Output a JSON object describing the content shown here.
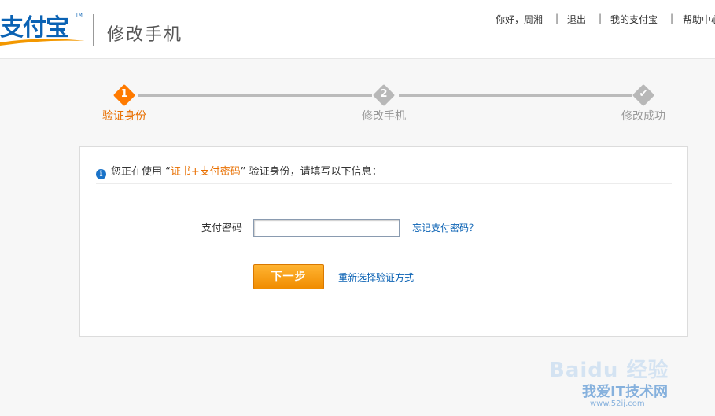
{
  "header": {
    "logo_text": "支付宝",
    "logo_tm": "TM",
    "page_title": "修改手机",
    "nav": {
      "greeting": "你好，周湘",
      "logout": "退出",
      "my_alipay": "我的支付宝",
      "help_center": "帮助中心"
    }
  },
  "steps": [
    {
      "number": "1",
      "label": "验证身份",
      "state": "active"
    },
    {
      "number": "2",
      "label": "修改手机",
      "state": "pending"
    },
    {
      "number": "✔",
      "label": "修改成功",
      "state": "pending"
    }
  ],
  "main": {
    "info_icon": "info-icon",
    "info_prefix": "您正在使用 “",
    "info_method": "证书+支付密码",
    "info_suffix": "” 验证身份，请填写以下信息：",
    "password_label": "支付密码",
    "password_value": "",
    "forgot_link": "忘记支付密码？",
    "next_button": "下一步",
    "reselect_link": "重新选择验证方式"
  },
  "watermark": {
    "brand": "Baidu 经验",
    "site_name": "我爱IT技术网",
    "site_url": "www.52ij.com"
  },
  "colors": {
    "accent_orange": "#ff7a00",
    "link_blue": "#0a62b4",
    "logo_blue": "#0a62b4"
  }
}
